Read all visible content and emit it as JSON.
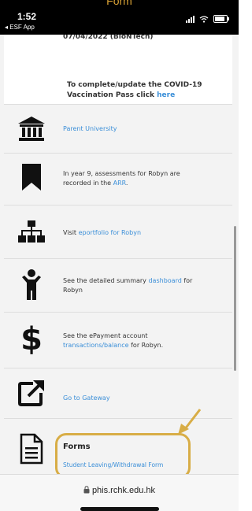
{
  "caption": "Form",
  "status_bar": {
    "time": "1:52",
    "back_app": "◂ ESF App"
  },
  "page": {
    "date_text": "07/04/2022 (BioNTech)",
    "covid": {
      "text": "To complete/update the COVID-19 Vaccination Pass click ",
      "link": "here"
    },
    "items": [
      {
        "icon": "university-building-icon",
        "text_before": "",
        "link": "Parent University",
        "text_after": ""
      },
      {
        "icon": "bookmark-icon",
        "text_before": "In year 9, assessments for Robyn are recorded in the ",
        "link": "ARR",
        "text_after": "."
      },
      {
        "icon": "sitemap-icon",
        "text_before": "Visit ",
        "link": "eportfolio for Robyn",
        "text_after": ""
      },
      {
        "icon": "child-person-icon",
        "text_before": "See the detailed summary ",
        "link": "dashboard",
        "text_after": " for Robyn"
      },
      {
        "icon": "dollar-sign-icon",
        "text_before": "See the ePayment account ",
        "link": "transactions/balance",
        "text_after": " for Robyn."
      },
      {
        "icon": "external-link-icon",
        "text_before": "",
        "link": "Go to Gateway",
        "text_after": ""
      }
    ],
    "forms": {
      "icon": "document-icon",
      "title": "Forms",
      "link": "Student Leaving/Withdrawal Form"
    }
  },
  "browser": {
    "url": "phis.rchk.edu.hk",
    "lock_icon": "lock-icon"
  },
  "colors": {
    "link": "#3b8fd8",
    "highlight": "#d8ad46",
    "status_bar": "#000000",
    "row_bg": "#f3f3f3"
  }
}
